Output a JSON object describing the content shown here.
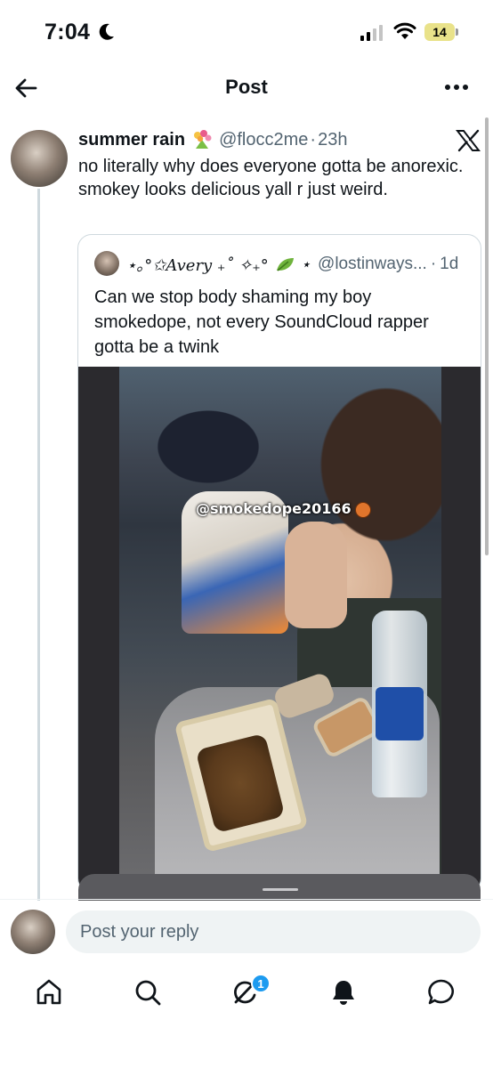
{
  "status_bar": {
    "time": "7:04",
    "battery": "14"
  },
  "header": {
    "title": "Post"
  },
  "post": {
    "author_name": "summer rain",
    "author_handle": "@flocc2me",
    "time_sep": "·",
    "time": "23h",
    "text": "no literally why does everyone gotta be anorexic. smokey looks delicious yall r just weird."
  },
  "quote": {
    "author_name": "⋆｡°✩Avery ₊˚ ✧₊° ",
    "author_suffix": "⋆",
    "author_handle": "@lostinways...",
    "time_sep": "·",
    "time": "1d",
    "text": "Can we stop body shaming my boy smokedope, not every SoundCloud rapper gotta be a twink",
    "image_watermark": "@smokedope20166"
  },
  "reply": {
    "placeholder": "Post your reply"
  },
  "tabs": {
    "notifications_badge": "1"
  },
  "colors": {
    "accent": "#1d9bf0",
    "text_primary": "#0f1419",
    "text_secondary": "#536471",
    "border": "#cfd9de"
  },
  "icons": {
    "back": "arrow-left-icon",
    "more": "more-horizontal-icon",
    "x_logo": "x-logo-icon",
    "home": "home-icon",
    "search": "search-icon",
    "grok": "grok-icon",
    "notifications": "bell-icon",
    "messages": "chat-bubble-icon"
  }
}
